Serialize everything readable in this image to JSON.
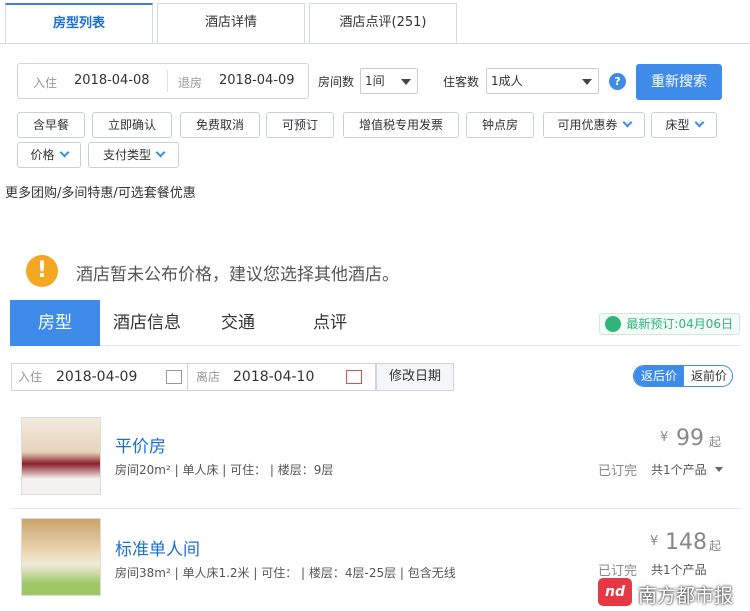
{
  "top_tabs": [
    {
      "label": "房型列表"
    },
    {
      "label": "酒店详情"
    },
    {
      "label": "酒店点评(251)"
    }
  ],
  "search": {
    "checkin_label": "入住",
    "checkin": "2018-04-08",
    "checkout_label": "退房",
    "checkout": "2018-04-09",
    "rooms_label": "房间数",
    "rooms": "1间",
    "guests_label": "住客数",
    "guests": "1成人",
    "help": "?",
    "search_button": "重新搜索"
  },
  "filters": [
    "含早餐",
    "立即确认",
    "免费取消",
    "可预订",
    "增值税专用发票",
    "钟点房",
    "可用优惠券",
    "床型",
    "价格",
    "支付类型"
  ],
  "promo": "更多团购/多间特惠/可选套餐优惠",
  "notice": "酒店暂未公布价格，建议您选择其他酒店。",
  "nav2": {
    "tabs": [
      "房型",
      "酒店信息",
      "交通",
      "点评"
    ],
    "latest_booking": "最新预订:04月06日"
  },
  "dates2": {
    "checkin_label": "入住",
    "checkin": "2018-04-09",
    "checkout_label": "离店",
    "checkout": "2018-04-10",
    "modify": "修改日期",
    "after_tax": "返后价",
    "before_tax": "返前价"
  },
  "rooms": [
    {
      "name": "平价房",
      "details": "房间20m²  |  单人床  |  可住：  |  楼层：9层",
      "currency": "¥",
      "price": "99",
      "qi": "起",
      "sold_out": "已订完",
      "products": "共1个产品"
    },
    {
      "name": "标准单人间",
      "details": "房间38m²  |  单人床1.2米  |  可住：  |  楼层：4层-25层  |  包含无线",
      "currency": "¥",
      "price": "148",
      "qi": "起",
      "sold_out": "已订完",
      "products": "共1个产品"
    }
  ],
  "watermark": {
    "logo": "nd",
    "text": "南方都市报"
  },
  "colors": {
    "accent": "#3f8bea",
    "link": "#1a6fd6",
    "warning": "#f5a623",
    "green": "#2fb47a"
  }
}
